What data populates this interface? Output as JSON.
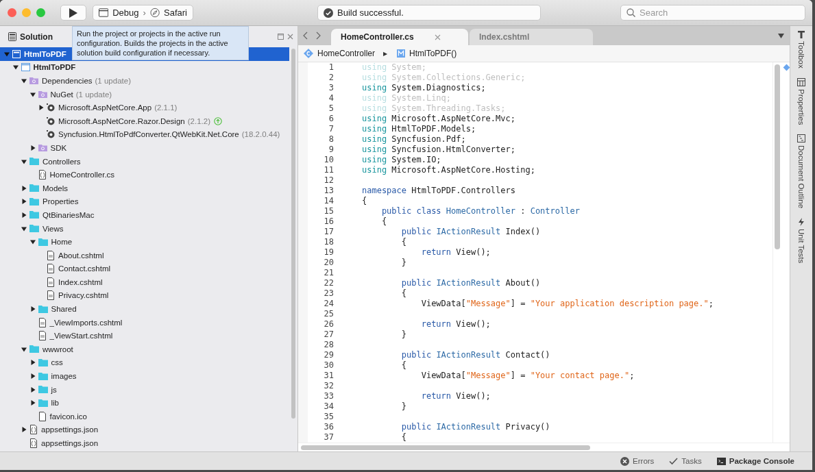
{
  "toolbar": {
    "configuration": "Debug",
    "separator": "›",
    "target": "Safari",
    "status": "Build successful.",
    "search": {
      "placeholder": "Search"
    }
  },
  "tooltip": {
    "text": "Run the project or projects in the active run configuration. Builds the projects in the active solution build configuration if necessary."
  },
  "solution_pad": {
    "title": "Solution",
    "tree": [
      {
        "label": "HtmlToPDF",
        "kind": "solution",
        "expanded": true,
        "selected": true,
        "children": [
          {
            "label": "HtmlToPDF",
            "kind": "project",
            "bold": true,
            "expanded": true,
            "selected": false,
            "children": [
              {
                "label": "Dependencies",
                "note": "(1 update)",
                "kind": "package-folder",
                "expanded": true,
                "selected": false,
                "children": [
                  {
                    "label": "NuGet",
                    "note": "(1 update)",
                    "kind": "package-folder",
                    "expanded": true,
                    "selected": false,
                    "children": [
                      {
                        "label": "Microsoft.AspNetCore.App",
                        "note": "(2.1.1)",
                        "kind": "package",
                        "expanded": false,
                        "selected": false
                      },
                      {
                        "label": "Microsoft.AspNetCore.Razor.Design",
                        "note": "(2.1.2)",
                        "kind": "package",
                        "update_available": true,
                        "selected": false
                      },
                      {
                        "label": "Syncfusion.HtmlToPdfConverter.QtWebKit.Net.Core",
                        "note": "(18.2.0.44)",
                        "kind": "package",
                        "selected": false
                      }
                    ]
                  },
                  {
                    "label": "SDK",
                    "kind": "package-folder",
                    "expanded": false,
                    "selected": false
                  }
                ]
              },
              {
                "label": "Controllers",
                "kind": "folder",
                "expanded": true,
                "selected": false,
                "children": [
                  {
                    "label": "HomeController.cs",
                    "kind": "code-file",
                    "selected": false
                  }
                ]
              },
              {
                "label": "Models",
                "kind": "folder",
                "expanded": false,
                "selected": false
              },
              {
                "label": "Properties",
                "kind": "folder",
                "expanded": false,
                "selected": false
              },
              {
                "label": "QtBinariesMac",
                "kind": "folder",
                "expanded": false,
                "selected": false
              },
              {
                "label": "Views",
                "kind": "folder",
                "expanded": true,
                "selected": false,
                "children": [
                  {
                    "label": "Home",
                    "kind": "folder",
                    "expanded": true,
                    "selected": false,
                    "children": [
                      {
                        "label": "About.cshtml",
                        "kind": "css-file",
                        "selected": false
                      },
                      {
                        "label": "Contact.cshtml",
                        "kind": "css-file",
                        "selected": false
                      },
                      {
                        "label": "Index.cshtml",
                        "kind": "css-file",
                        "selected": false
                      },
                      {
                        "label": "Privacy.cshtml",
                        "kind": "css-file",
                        "selected": false
                      }
                    ]
                  },
                  {
                    "label": "Shared",
                    "kind": "folder",
                    "expanded": false,
                    "selected": false
                  },
                  {
                    "label": "_ViewImports.cshtml",
                    "kind": "css-file",
                    "selected": false
                  },
                  {
                    "label": "_ViewStart.cshtml",
                    "kind": "css-file",
                    "selected": false
                  }
                ]
              },
              {
                "label": "wwwroot",
                "kind": "folder",
                "expanded": true,
                "selected": false,
                "children": [
                  {
                    "label": "css",
                    "kind": "folder",
                    "expanded": false,
                    "selected": false
                  },
                  {
                    "label": "images",
                    "kind": "folder",
                    "expanded": false,
                    "selected": false
                  },
                  {
                    "label": "js",
                    "kind": "folder",
                    "expanded": false,
                    "selected": false
                  },
                  {
                    "label": "lib",
                    "kind": "folder",
                    "expanded": false,
                    "selected": false
                  },
                  {
                    "label": "favicon.ico",
                    "kind": "file",
                    "selected": false
                  }
                ]
              },
              {
                "label": "appsettings.json",
                "kind": "code-file",
                "expanded": false,
                "selected": false
              },
              {
                "label": "appsettings.json",
                "kind": "code-file",
                "selected": false
              }
            ]
          }
        ]
      }
    ]
  },
  "editor": {
    "tabs": [
      {
        "label": "HomeController.cs",
        "selected": true
      },
      {
        "label": "Index.cshtml",
        "selected": false
      }
    ],
    "breadcrumb": {
      "class": "HomeController",
      "separator": "▶",
      "method": "HtmlToPDF()"
    },
    "lines": [
      {
        "number": "1",
        "faded": true,
        "tokens": [
          {
            "kind": "directive",
            "text": "using"
          },
          {
            "kind": "plain",
            "text": " System;"
          }
        ]
      },
      {
        "number": "2",
        "faded": true,
        "tokens": [
          {
            "kind": "directive",
            "text": "using"
          },
          {
            "kind": "plain",
            "text": " System.Collections.Generic;"
          }
        ]
      },
      {
        "number": "3",
        "faded": false,
        "tokens": [
          {
            "kind": "directive",
            "text": "using"
          },
          {
            "kind": "plain",
            "text": " System.Diagnostics;"
          }
        ]
      },
      {
        "number": "4",
        "faded": true,
        "tokens": [
          {
            "kind": "directive",
            "text": "using"
          },
          {
            "kind": "plain",
            "text": " System.Linq;"
          }
        ]
      },
      {
        "number": "5",
        "faded": true,
        "tokens": [
          {
            "kind": "directive",
            "text": "using"
          },
          {
            "kind": "plain",
            "text": " System.Threading.Tasks;"
          }
        ]
      },
      {
        "number": "6",
        "faded": false,
        "tokens": [
          {
            "kind": "directive",
            "text": "using"
          },
          {
            "kind": "plain",
            "text": " Microsoft.AspNetCore.Mvc;"
          }
        ]
      },
      {
        "number": "7",
        "faded": false,
        "tokens": [
          {
            "kind": "directive",
            "text": "using"
          },
          {
            "kind": "plain",
            "text": " HtmlToPDF.Models;"
          }
        ]
      },
      {
        "number": "8",
        "faded": false,
        "tokens": [
          {
            "kind": "directive",
            "text": "using"
          },
          {
            "kind": "plain",
            "text": " Syncfusion.Pdf;"
          }
        ]
      },
      {
        "number": "9",
        "faded": false,
        "tokens": [
          {
            "kind": "directive",
            "text": "using"
          },
          {
            "kind": "plain",
            "text": " Syncfusion.HtmlConverter;"
          }
        ]
      },
      {
        "number": "10",
        "faded": false,
        "tokens": [
          {
            "kind": "directive",
            "text": "using"
          },
          {
            "kind": "plain",
            "text": " System.IO;"
          }
        ]
      },
      {
        "number": "11",
        "faded": false,
        "tokens": [
          {
            "kind": "directive",
            "text": "using"
          },
          {
            "kind": "plain",
            "text": " Microsoft.AspNetCore.Hosting;"
          }
        ]
      },
      {
        "number": "12"
      },
      {
        "number": "13",
        "faded": false,
        "tokens": [
          {
            "kind": "keyword",
            "text": "namespace"
          },
          {
            "kind": "plain",
            "text": " HtmlToPDF.Controllers"
          }
        ]
      },
      {
        "number": "14",
        "faded": false,
        "tokens": [
          {
            "kind": "plain",
            "text": "{"
          }
        ]
      },
      {
        "number": "15",
        "faded": false,
        "tokens": [
          {
            "kind": "keyword",
            "text": "    public class"
          },
          {
            "kind": "type",
            "text": " HomeController"
          },
          {
            "kind": "plain",
            "text": " : "
          },
          {
            "kind": "type",
            "text": "Controller"
          }
        ]
      },
      {
        "number": "16",
        "faded": false,
        "tokens": [
          {
            "kind": "plain",
            "text": "    {"
          }
        ]
      },
      {
        "number": "17",
        "faded": false,
        "tokens": [
          {
            "kind": "keyword",
            "text": "        public"
          },
          {
            "kind": "type",
            "text": " IActionResult"
          },
          {
            "kind": "plain",
            "text": " Index()"
          }
        ]
      },
      {
        "number": "18",
        "faded": false,
        "tokens": [
          {
            "kind": "plain",
            "text": "        {"
          }
        ]
      },
      {
        "number": "19",
        "faded": false,
        "tokens": [
          {
            "kind": "keyword",
            "text": "            return"
          },
          {
            "kind": "plain",
            "text": " View();"
          }
        ]
      },
      {
        "number": "20",
        "faded": false,
        "tokens": [
          {
            "kind": "plain",
            "text": "        }"
          }
        ]
      },
      {
        "number": "21"
      },
      {
        "number": "22",
        "faded": false,
        "tokens": [
          {
            "kind": "keyword",
            "text": "        public"
          },
          {
            "kind": "type",
            "text": " IActionResult"
          },
          {
            "kind": "plain",
            "text": " About()"
          }
        ]
      },
      {
        "number": "23",
        "faded": false,
        "tokens": [
          {
            "kind": "plain",
            "text": "        {"
          }
        ]
      },
      {
        "number": "24",
        "faded": false,
        "tokens": [
          {
            "kind": "plain",
            "text": "            ViewData["
          },
          {
            "kind": "string",
            "text": "\"Message\""
          },
          {
            "kind": "plain",
            "text": "] = "
          },
          {
            "kind": "string",
            "text": "\"Your application description page.\""
          },
          {
            "kind": "plain",
            "text": ";"
          }
        ]
      },
      {
        "number": "25"
      },
      {
        "number": "26",
        "faded": false,
        "tokens": [
          {
            "kind": "keyword",
            "text": "            return"
          },
          {
            "kind": "plain",
            "text": " View();"
          }
        ]
      },
      {
        "number": "27",
        "faded": false,
        "tokens": [
          {
            "kind": "plain",
            "text": "        }"
          }
        ]
      },
      {
        "number": "28"
      },
      {
        "number": "29",
        "faded": false,
        "tokens": [
          {
            "kind": "keyword",
            "text": "        public"
          },
          {
            "kind": "type",
            "text": " IActionResult"
          },
          {
            "kind": "plain",
            "text": " Contact()"
          }
        ]
      },
      {
        "number": "30",
        "faded": false,
        "tokens": [
          {
            "kind": "plain",
            "text": "        {"
          }
        ]
      },
      {
        "number": "31",
        "faded": false,
        "tokens": [
          {
            "kind": "plain",
            "text": "            ViewData["
          },
          {
            "kind": "string",
            "text": "\"Message\""
          },
          {
            "kind": "plain",
            "text": "] = "
          },
          {
            "kind": "string",
            "text": "\"Your contact page.\""
          },
          {
            "kind": "plain",
            "text": ";"
          }
        ]
      },
      {
        "number": "32"
      },
      {
        "number": "33",
        "faded": false,
        "tokens": [
          {
            "kind": "keyword",
            "text": "            return"
          },
          {
            "kind": "plain",
            "text": " View();"
          }
        ]
      },
      {
        "number": "34",
        "faded": false,
        "tokens": [
          {
            "kind": "plain",
            "text": "        }"
          }
        ]
      },
      {
        "number": "35"
      },
      {
        "number": "36",
        "faded": false,
        "tokens": [
          {
            "kind": "keyword",
            "text": "        public"
          },
          {
            "kind": "type",
            "text": " IActionResult"
          },
          {
            "kind": "plain",
            "text": " Privacy()"
          }
        ]
      },
      {
        "number": "37",
        "faded": false,
        "tokens": [
          {
            "kind": "plain",
            "text": "        {"
          }
        ]
      }
    ]
  },
  "side_tabs": [
    {
      "label": "Toolbox"
    },
    {
      "label": "Properties"
    },
    {
      "label": "Document Outline"
    },
    {
      "label": "Unit Tests"
    }
  ],
  "status_bar": {
    "items": [
      {
        "label": "Errors",
        "bold": false
      },
      {
        "label": "Tasks",
        "bold": false
      },
      {
        "label": "Package Console",
        "bold": true
      }
    ]
  }
}
